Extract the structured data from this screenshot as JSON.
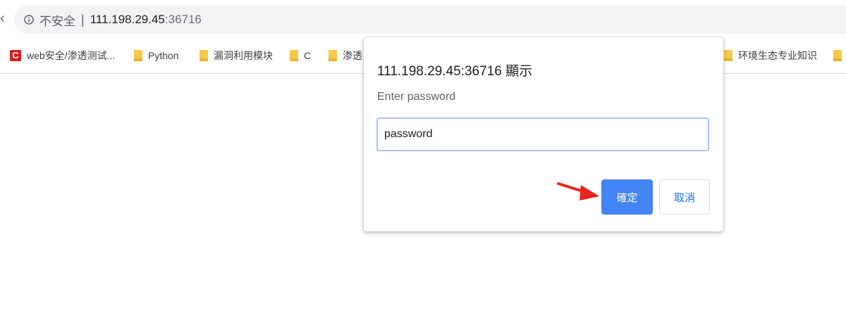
{
  "address_bar": {
    "security_label": "不安全",
    "separator": "|",
    "url_host": "111.198.29.45",
    "url_port": ":36716"
  },
  "bookmarks": [
    {
      "label": "web安全/渗透测试...",
      "icon": "site-icon-red-c",
      "icon_text": "C"
    },
    {
      "label": "Python",
      "icon": "folder-icon"
    },
    {
      "label": "漏洞利用模块",
      "icon": "folder-icon"
    },
    {
      "label": "C",
      "icon": "folder-icon"
    },
    {
      "label": "渗透",
      "icon": "folder-icon"
    },
    {
      "label": "环境生态专业知识",
      "icon": "folder-icon"
    }
  ],
  "dialog": {
    "title": "111.198.29.45:36716 顯示",
    "prompt": "Enter password",
    "input_value": "password",
    "ok_label": "確定",
    "cancel_label": "取消"
  },
  "colors": {
    "primary_button": "#4285f4",
    "annotation_arrow": "#e8231b",
    "folder": "#f7c948"
  }
}
